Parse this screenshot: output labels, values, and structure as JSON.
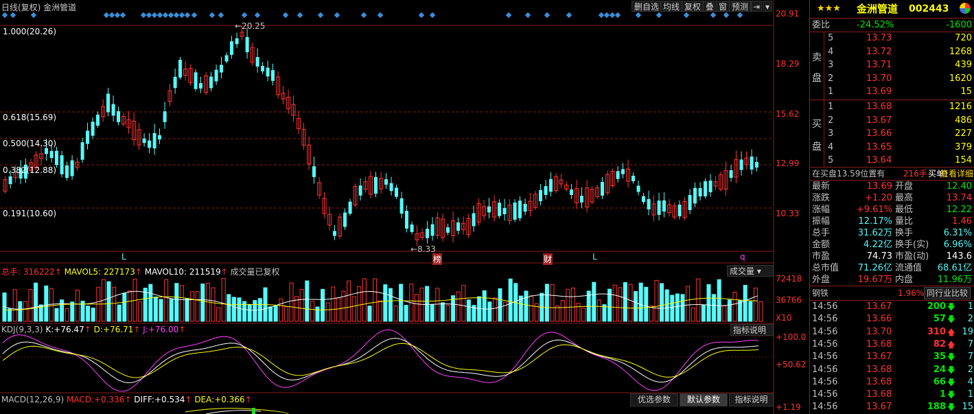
{
  "chart_header": {
    "title": "日线(复权) 金洲管道",
    "buttons": [
      "删自选",
      "均线",
      "复权",
      "叠",
      "窗",
      "预测"
    ]
  },
  "price_axis": [
    "20.91",
    "18.29",
    "15.62",
    "12.99",
    "10.33"
  ],
  "fib_levels": [
    "1.000(20.26)",
    "0.618(15.69)",
    "0.500(14.30)",
    "0.382(12.88)",
    "0.191(10.60)"
  ],
  "annotations": {
    "high": "20.25",
    "low": "8.33"
  },
  "markers": [
    "L",
    "榜",
    "财",
    "L",
    "q"
  ],
  "volume": {
    "prefix": "总手:",
    "total": "316222",
    "ma5_label": "MAVOL5:",
    "ma5": "227173",
    "ma10_label": "MAVOL10:",
    "ma10": "211519",
    "note": "成交量已复权",
    "dropdown": "成交量",
    "axis": [
      "72418",
      "36766",
      "X10"
    ]
  },
  "kdj": {
    "name": "KDJ(9,3,3)",
    "k_label": "K:",
    "k": "+76.47",
    "d_label": "D:",
    "d": "+76.71",
    "j_label": "J:",
    "j": "+76.00",
    "help": "指标说明",
    "axis": [
      "+100.0",
      "+50.62"
    ]
  },
  "macd": {
    "name": "MACD(12,26,9)",
    "macd_label": "MACD:",
    "macd": "+0.336",
    "diff_label": "DIFF:",
    "diff": "+0.534",
    "dea_label": "DEA:",
    "dea": "+0.366",
    "buttons": [
      "优选参数",
      "默认参数",
      "指标说明"
    ],
    "axis": "+1.19"
  },
  "quote": {
    "stars": "★★★",
    "name": "金洲管道",
    "code": "002443",
    "weibi_label": "委比",
    "weibi": "-24.52%",
    "weicha": "-1600",
    "sell_label": [
      "卖",
      "盘"
    ],
    "buy_label": [
      "买",
      "盘"
    ],
    "sell": [
      {
        "lvl": "5",
        "price": "13.73",
        "vol": "720"
      },
      {
        "lvl": "4",
        "price": "13.72",
        "vol": "1268"
      },
      {
        "lvl": "3",
        "price": "13.71",
        "vol": "439"
      },
      {
        "lvl": "2",
        "price": "13.70",
        "vol": "1620"
      },
      {
        "lvl": "1",
        "price": "13.69",
        "vol": "15"
      }
    ],
    "buy": [
      {
        "lvl": "1",
        "price": "13.68",
        "vol": "1216"
      },
      {
        "lvl": "2",
        "price": "13.67",
        "vol": "486"
      },
      {
        "lvl": "3",
        "price": "13.66",
        "vol": "227"
      },
      {
        "lvl": "4",
        "price": "13.65",
        "vol": "379"
      },
      {
        "lvl": "5",
        "price": "13.64",
        "vol": "154"
      }
    ],
    "notice_a": "在买盘13.59位置有",
    "notice_b": "216手",
    "notice_c": "买单!",
    "notice_d": "查看详细",
    "stats": [
      {
        "l1": "最新",
        "v1": "13.69",
        "c1": "red",
        "l2": "开盘",
        "v2": "12.40",
        "c2": "green"
      },
      {
        "l1": "涨跌",
        "v1": "+1.20",
        "c1": "red",
        "l2": "最高",
        "v2": "13.74",
        "c2": "red"
      },
      {
        "l1": "涨幅",
        "v1": "+9.61%",
        "c1": "red",
        "l2": "最低",
        "v2": "12.22",
        "c2": "green"
      },
      {
        "l1": "振幅",
        "v1": "12.17%",
        "c1": "cyan",
        "l2": "量比",
        "v2": "1.46",
        "c2": "red"
      },
      {
        "l1": "总手",
        "v1": "31.62万",
        "c1": "cyan",
        "l2": "换手",
        "v2": "6.31%",
        "c2": "cyan"
      },
      {
        "l1": "金额",
        "v1": "4.22亿",
        "c1": "cyan",
        "l2": "换手(实)",
        "v2": "6.96%",
        "c2": "cyan"
      },
      {
        "l1": "市盈",
        "v1": "74.73",
        "c1": "white",
        "l2": "市盈(动)",
        "v2": "143.6",
        "c2": "white"
      },
      {
        "l1": "总市值",
        "v1": "71.26亿",
        "c1": "cyan",
        "l2": "流通值",
        "v2": "68.61亿",
        "c2": "cyan"
      },
      {
        "l1": "外盘",
        "v1": "19.67万",
        "c1": "red",
        "l2": "内盘",
        "v2": "11.96万",
        "c2": "green"
      }
    ],
    "industry": "钢铁",
    "industry_pct": "1.96%",
    "compare_btn": "同行业比较",
    "ticks": [
      {
        "t": "14:56",
        "p": "13.67",
        "v": "200",
        "dir": "down",
        "n": "1"
      },
      {
        "t": "14:56",
        "p": "13.66",
        "v": "57",
        "dir": "down",
        "n": "2"
      },
      {
        "t": "14:56",
        "p": "13.70",
        "v": "310",
        "dir": "up",
        "n": "19"
      },
      {
        "t": "14:56",
        "p": "13.68",
        "v": "82",
        "dir": "up",
        "n": "7"
      },
      {
        "t": "14:56",
        "p": "13.67",
        "v": "35",
        "dir": "down",
        "n": "7"
      },
      {
        "t": "14:56",
        "p": "13.68",
        "v": "24",
        "dir": "down",
        "n": "2"
      },
      {
        "t": "14:56",
        "p": "13.68",
        "v": "66",
        "dir": "down",
        "n": "4"
      },
      {
        "t": "14:56",
        "p": "13.68",
        "v": "1",
        "dir": "down",
        "n": "1"
      },
      {
        "t": "14:56",
        "p": "13.67",
        "v": "188",
        "dir": "down",
        "n": "15"
      }
    ]
  },
  "colors": {
    "up": "#ff3232",
    "down": "#54fcfc",
    "bg": "#000000",
    "grid": "#8a1c1c",
    "volma5": "#ffffff",
    "volma10": "#ffff00",
    "k": "#ffffff",
    "d": "#ffff00",
    "j": "#ff40ff",
    "marker": "#3a8fd8"
  }
}
